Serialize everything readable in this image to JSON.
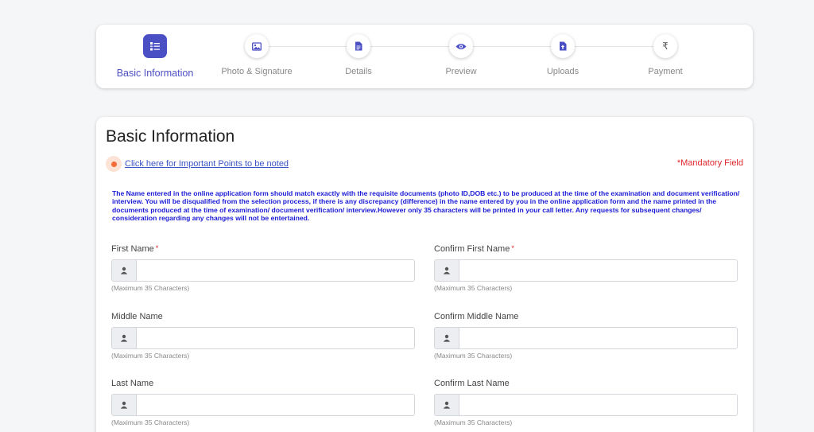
{
  "stepper": {
    "steps": [
      {
        "label": "Basic Information",
        "icon": "list-icon",
        "active": true
      },
      {
        "label": "Photo & Signature",
        "icon": "image-icon",
        "active": false
      },
      {
        "label": "Details",
        "icon": "document-icon",
        "active": false
      },
      {
        "label": "Preview",
        "icon": "eye-icon",
        "active": false
      },
      {
        "label": "Uploads",
        "icon": "upload-file-icon",
        "active": false
      },
      {
        "label": "Payment",
        "icon": "rupee-icon",
        "active": false
      }
    ]
  },
  "form": {
    "title": "Basic Information",
    "points_link": "Click here for Important Points to be noted",
    "mandatory_label": "*Mandatory Field",
    "notice": "The Name entered in the online application form should match exactly with the requisite documents (photo ID,DOB etc.) to be produced at the time of the examination and document verification/ interview. You will be disqualified from the selection process, if there is any discrepancy (difference) in the name entered by you in the online application form and the name printed in the documents produced at the time of examination/ document verification/ interview.However only 35 characters will be printed in your call letter. Any requests for subsequent changes/ consideration regarding any changes will not be entertained.",
    "fields": {
      "first_name": {
        "label": "First Name",
        "required_mark": "*",
        "value": "",
        "hint": "(Maximum 35 Characters)"
      },
      "confirm_first_name": {
        "label": "Confirm First Name",
        "required_mark": "*",
        "value": "",
        "hint": "(Maximum 35 Characters)"
      },
      "middle_name": {
        "label": "Middle Name",
        "value": "",
        "hint": "(Maximum 35 Characters)"
      },
      "confirm_middle_name": {
        "label": "Confirm Middle Name",
        "value": "",
        "hint": "(Maximum 35 Characters)"
      },
      "last_name": {
        "label": "Last Name",
        "value": "",
        "hint": "(Maximum 35 Characters)"
      },
      "confirm_last_name": {
        "label": "Confirm Last Name",
        "value": "",
        "hint": "(Maximum 35 Characters)"
      }
    }
  },
  "colors": {
    "accent": "#4b4fc4",
    "required": "#e0282c",
    "notice_text": "#1a1ad6",
    "link": "#3a53c5",
    "bullet": "#f36d3a"
  }
}
